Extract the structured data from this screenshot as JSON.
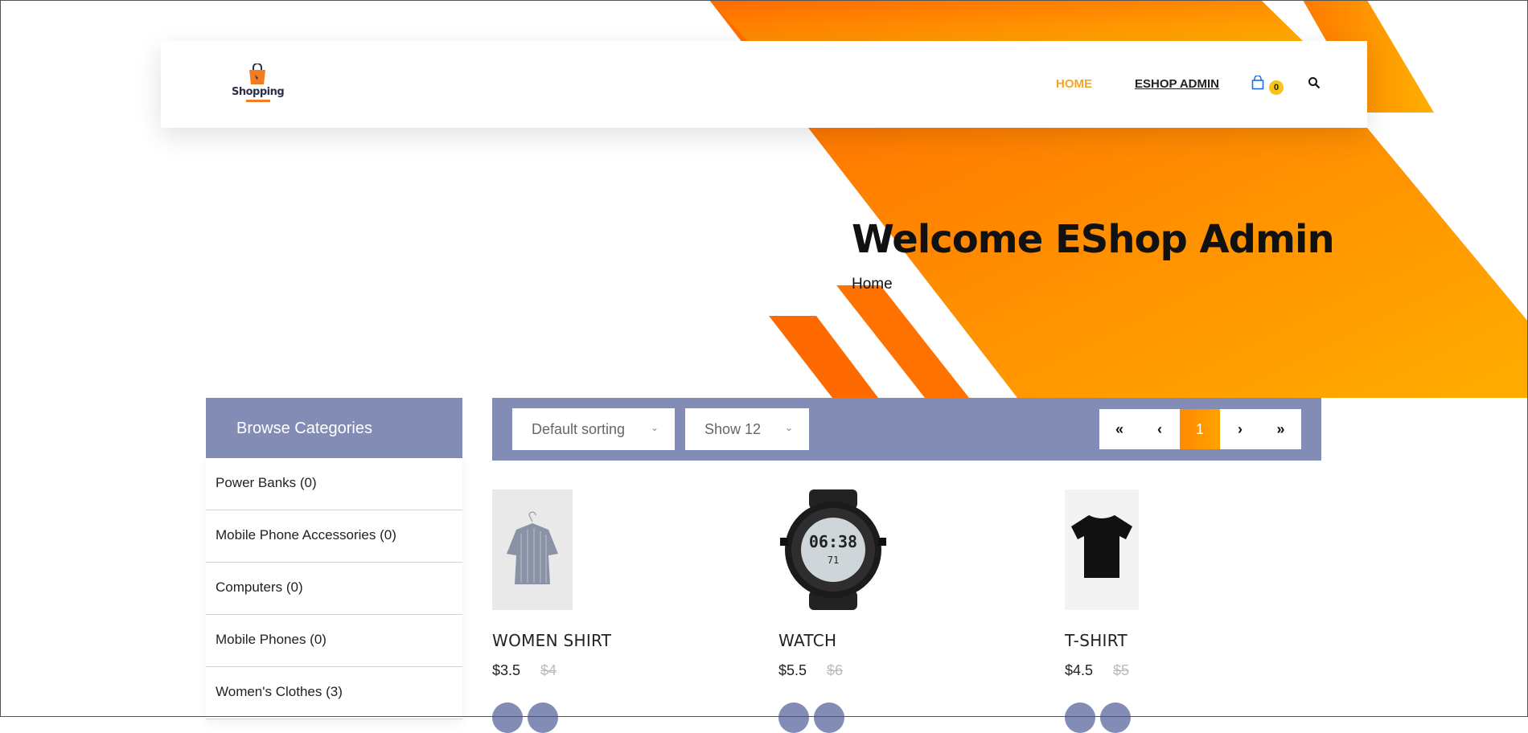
{
  "header": {
    "logo_text": "Shopping",
    "nav": {
      "home": "HOME",
      "admin": "ESHOP ADMIN"
    },
    "cart_count": "0"
  },
  "hero": {
    "title": "Welcome EShop Admin",
    "breadcrumb": "Home"
  },
  "sidebar": {
    "heading": "Browse Categories",
    "categories": [
      "Power Banks (0)",
      "Mobile Phone Accessories (0)",
      "Computers (0)",
      "Mobile Phones (0)",
      "Women's Clothes (3)"
    ]
  },
  "toolbar": {
    "sort_value": "Default sorting",
    "show_value": "Show 12",
    "pager": {
      "first": "«",
      "prev": "‹",
      "current": "1",
      "next": "›",
      "last": "»"
    }
  },
  "products": [
    {
      "name": "WOMEN SHIRT",
      "price": "$3.5",
      "old_price": "$4"
    },
    {
      "name": "WATCH",
      "price": "$5.5",
      "old_price": "$6"
    },
    {
      "name": "T-SHIRT",
      "price": "$4.5",
      "old_price": "$5"
    }
  ],
  "colors": {
    "accent": "#ff8a00",
    "nav_active": "#f5a623",
    "panel": "#838cb5",
    "badge": "#f5c518"
  }
}
